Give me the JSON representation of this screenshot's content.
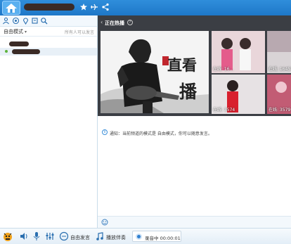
{
  "titlebar": {
    "icons": [
      "home-icon",
      "star-icon",
      "airplane-icon",
      "share-icon"
    ]
  },
  "left_toolbar": {
    "icons": [
      "people-icon",
      "badge-icon",
      "location-pin-icon",
      "flag-icon",
      "search-icon"
    ]
  },
  "mode_row": {
    "mode_label": "自由模式",
    "hint": "所有人可以发言"
  },
  "live": {
    "back_symbol": "‹",
    "title": "正在热播",
    "info_symbol": "?",
    "feature_line1": "直看",
    "feature_line2": "播",
    "thumbs": [
      {
        "count": "在线: 16...",
        "background": "#c9c0c4"
      },
      {
        "count": "在线: 16457",
        "background": "#d9d4d6"
      },
      {
        "count": "在线: 3574",
        "background": "#d9c2c9"
      },
      {
        "count": "在线: 3579",
        "background": "#c25c74"
      }
    ]
  },
  "notice": {
    "icon_symbol": "i",
    "text": "通知：当前频道的模式是 自由模式，你可以随意发言。"
  },
  "bottom_bar": {
    "free_speak": "自由发言",
    "play_music": "播放伴奏",
    "record": "录音中 00:00:01"
  },
  "colors": {
    "titlebar": "#1e78c8",
    "accent": "#2f7fd0",
    "live_bg": "#3b3e44",
    "online_dot": "#5db33b"
  }
}
